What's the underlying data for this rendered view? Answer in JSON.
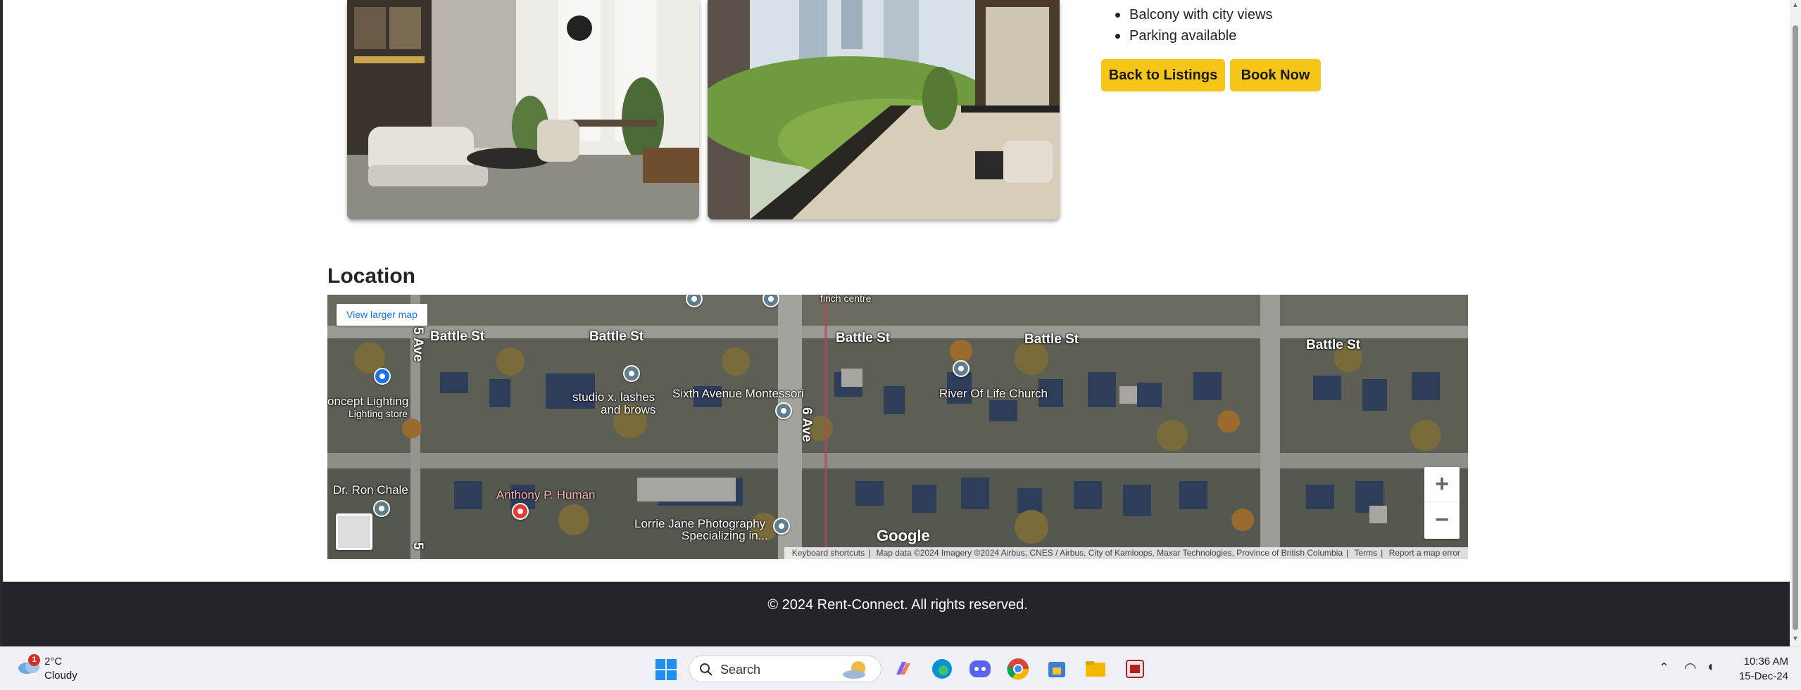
{
  "amenities": [
    "Balcony with city views",
    "Parking available"
  ],
  "buttons": {
    "back": "Back to Listings",
    "book": "Book Now"
  },
  "location": {
    "heading": "Location",
    "view_larger": "View larger map",
    "streets": {
      "battle": "Battle St",
      "sixth_ave": "6 Ave",
      "fifth_ave": "5 Ave",
      "five": "5"
    },
    "places": {
      "finch": "finch centre",
      "concept_lighting": "oncept Lighting",
      "lighting_store": "Lighting store",
      "studio_line1": "studio x. lashes",
      "studio_line2": "and brows",
      "montessori": "Sixth Avenue Montessori",
      "river_of_life": "River Of Life Church",
      "dr_chale": "Dr. Ron Chale",
      "anthony": "Anthony P. Human",
      "lorrie_line1": "Lorrie Jane Photography",
      "lorrie_line2": "Specializing in..."
    },
    "zoom_in": "+",
    "zoom_out": "−",
    "google": "Google",
    "attribution": {
      "shortcuts": "Keyboard shortcuts",
      "mapdata": "Map data ©2024 Imagery ©2024 Airbus, CNES / Airbus, City of Kamloops, Maxar Technologies, Province of British Columbia",
      "terms": "Terms",
      "report": "Report a map error"
    }
  },
  "footer": {
    "copyright": "© 2024 Rent-Connect. All rights reserved."
  },
  "taskbar": {
    "weather_badge": "1",
    "temperature": "2°C",
    "condition": "Cloudy",
    "search": "Search",
    "time": "10:36 AM",
    "date": "15-Dec-24"
  },
  "colors": {
    "accent_button": "#f5c518",
    "footer_bg": "#22252a",
    "map_link": "#1a73e8"
  }
}
